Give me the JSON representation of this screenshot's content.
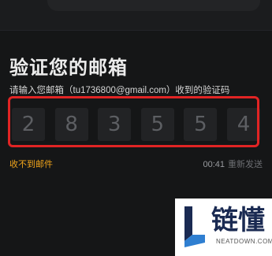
{
  "page": {
    "title": "验证您的邮箱",
    "prompt": "请输入您邮箱（tu1736800@gmail.com）收到的验证码",
    "code_digits": [
      "2",
      "8",
      "3",
      "5",
      "5",
      "4"
    ],
    "no_email_link": "收不到邮件",
    "resend_timer": "00:41",
    "resend_label": "重新发送"
  },
  "watermark": {
    "cn": "链懂",
    "en": "NEATDOWN.COM"
  },
  "colors": {
    "background": "#151617",
    "accent_orange": "#f0a41b",
    "highlight_red": "#e12424",
    "code_box": "#222325"
  }
}
